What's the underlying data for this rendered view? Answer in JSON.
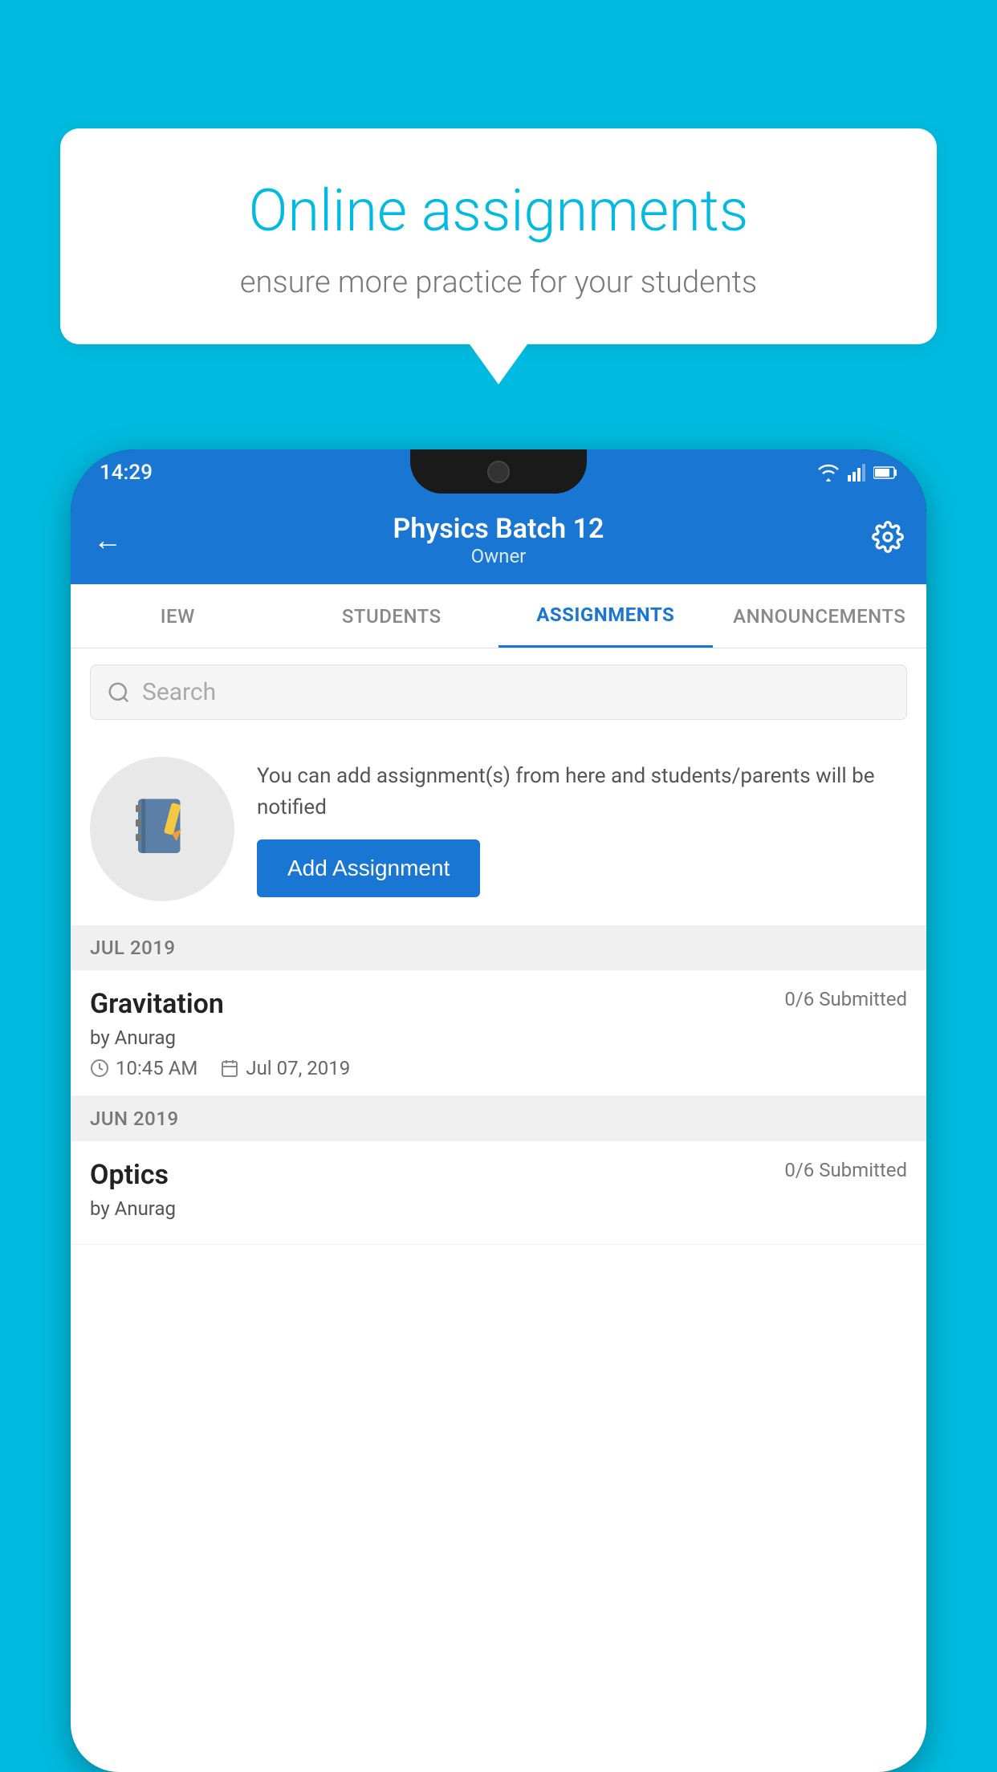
{
  "background_color": "#00BBDF",
  "speech_bubble": {
    "title": "Online assignments",
    "subtitle": "ensure more practice for your students"
  },
  "phone": {
    "status_bar": {
      "time": "14:29",
      "icons": [
        "wifi",
        "signal",
        "battery"
      ]
    },
    "header": {
      "title": "Physics Batch 12",
      "subtitle": "Owner",
      "back_label": "←",
      "settings_label": "⚙"
    },
    "tabs": [
      {
        "label": "IEW",
        "active": false
      },
      {
        "label": "STUDENTS",
        "active": false
      },
      {
        "label": "ASSIGNMENTS",
        "active": true
      },
      {
        "label": "ANNOUNCEMENTS",
        "active": false
      }
    ],
    "search": {
      "placeholder": "Search"
    },
    "promo": {
      "text": "You can add assignment(s) from here and students/parents will be notified",
      "button_label": "Add Assignment"
    },
    "sections": [
      {
        "label": "JUL 2019",
        "assignments": [
          {
            "name": "Gravitation",
            "submitted": "0/6 Submitted",
            "by": "by Anurag",
            "time": "10:45 AM",
            "date": "Jul 07, 2019"
          }
        ]
      },
      {
        "label": "JUN 2019",
        "assignments": [
          {
            "name": "Optics",
            "submitted": "0/6 Submitted",
            "by": "by Anurag",
            "time": "",
            "date": ""
          }
        ]
      }
    ]
  }
}
